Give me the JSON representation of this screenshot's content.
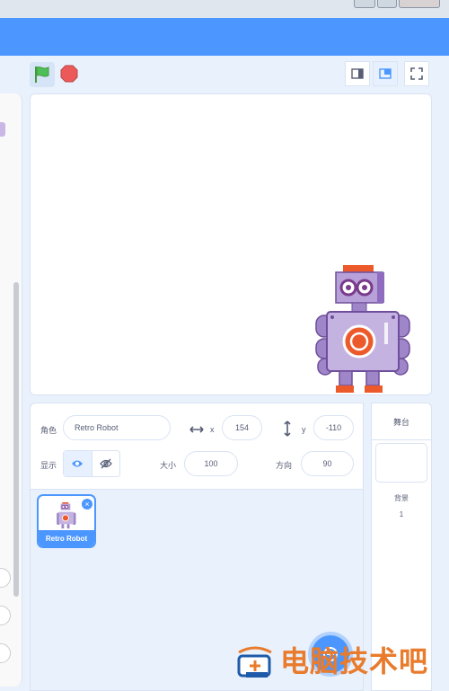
{
  "toolbar": {
    "green_flag_icon": "green-flag-icon",
    "stop_icon": "stop-icon",
    "view_buttons": [
      "small-stage-icon",
      "normal-stage-icon",
      "fullscreen-icon"
    ]
  },
  "stage": {
    "sprite_icon": "retro-robot-sprite"
  },
  "sprite_info": {
    "sprite_label": "角色",
    "sprite_name": "Retro Robot",
    "x_label": "x",
    "x_value": "154",
    "y_label": "y",
    "y_value": "-110",
    "show_label": "显示",
    "size_label": "大小",
    "size_value": "100",
    "direction_label": "方向",
    "direction_value": "90"
  },
  "sprite_list": [
    {
      "name": "Retro Robot",
      "selected": true
    }
  ],
  "stage_selector": {
    "title": "舞台",
    "backdrops_label": "背景",
    "backdrops_count": "1"
  },
  "watermark": {
    "text": "电脑技术吧"
  },
  "colors": {
    "accent": "#4c97ff",
    "menubar": "#4c97ff",
    "workspace": "#e9f1fc",
    "robot_body": "#b7a1d8",
    "robot_accent": "#ec5a2b",
    "watermark": "#e97b2c"
  }
}
